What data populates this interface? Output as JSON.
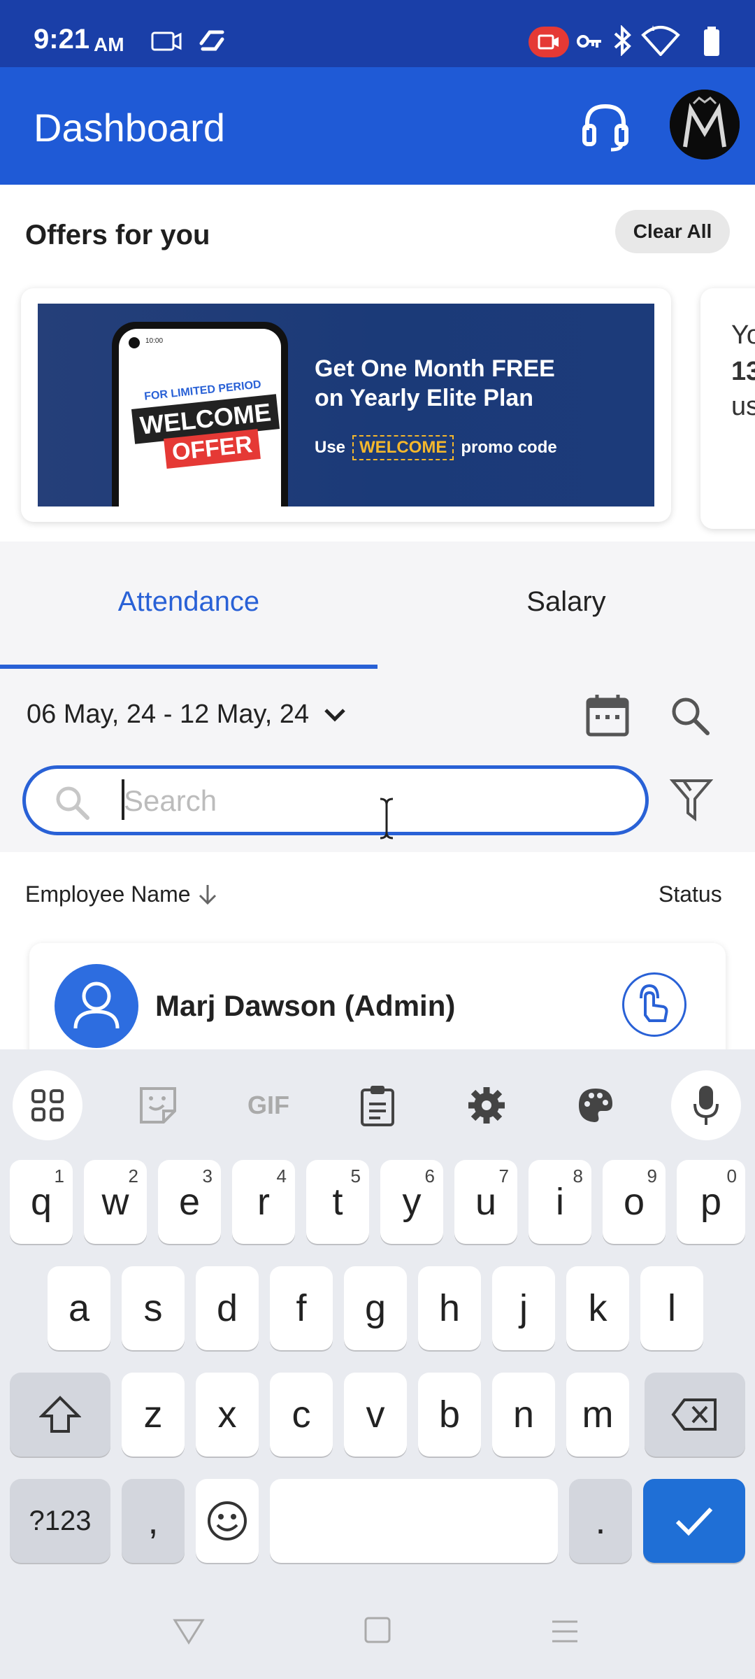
{
  "status_bar": {
    "time": "9:21",
    "time_suffix": "AM"
  },
  "app_bar": {
    "title": "Dashboard"
  },
  "offers": {
    "title": "Offers for you",
    "clear_all_label": "Clear All",
    "banner": {
      "phone_time": "10:00",
      "tag_small": "FOR LIMITED PERIOD",
      "tag_big_1": "WELCOME",
      "tag_big_2": "OFFER",
      "headline_1": "Get One Month FREE",
      "headline_2": "on Yearly Elite Plan",
      "use_label": "Use",
      "promo_code": "WELCOME",
      "promo_suffix": "promo code"
    },
    "peek_card": {
      "line1": "Yo",
      "line2": "13",
      "line3": "us"
    }
  },
  "tabs": [
    {
      "label": "Attendance",
      "active": true
    },
    {
      "label": "Salary",
      "active": false
    }
  ],
  "date_range": "06 May, 24 - 12 May, 24",
  "search": {
    "placeholder": "Search",
    "value": ""
  },
  "list": {
    "col_name": "Employee Name",
    "col_status": "Status",
    "employees": [
      {
        "name": "Marj Dawson (Admin)"
      }
    ]
  },
  "keyboard": {
    "row1": [
      {
        "key": "q",
        "hint": "1"
      },
      {
        "key": "w",
        "hint": "2"
      },
      {
        "key": "e",
        "hint": "3"
      },
      {
        "key": "r",
        "hint": "4"
      },
      {
        "key": "t",
        "hint": "5"
      },
      {
        "key": "y",
        "hint": "6"
      },
      {
        "key": "u",
        "hint": "7"
      },
      {
        "key": "i",
        "hint": "8"
      },
      {
        "key": "o",
        "hint": "9"
      },
      {
        "key": "p",
        "hint": "0"
      }
    ],
    "row2": [
      "a",
      "s",
      "d",
      "f",
      "g",
      "h",
      "j",
      "k",
      "l"
    ],
    "row3": [
      "z",
      "x",
      "c",
      "v",
      "b",
      "n",
      "m"
    ],
    "symbols_label": "?123",
    "comma": ",",
    "period": ".",
    "gif_label": "GIF"
  },
  "colors": {
    "primary": "#1f5ad6",
    "status_bar": "#1a3fa8",
    "accent_text": "#2961d6",
    "promo_yellow": "#f4b72c"
  }
}
